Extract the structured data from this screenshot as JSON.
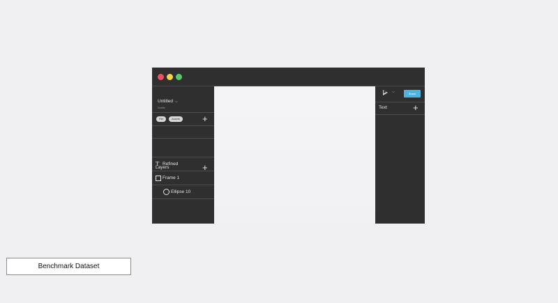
{
  "window": {
    "controls": {
      "close_color": "#e8555e",
      "minimize_color": "#f3d34a",
      "maximize_color": "#58c86a"
    }
  },
  "file": {
    "name": "Untitled",
    "name_chevron": "⌵",
    "subtitle": "Drafts"
  },
  "toolbar": {
    "pills": [
      "File",
      "Assets"
    ],
    "add_glyph": "+"
  },
  "layers": {
    "title": "Layers",
    "add_glyph": "+",
    "items": [
      {
        "label": "Refined",
        "icon": "text-icon",
        "glyph": "T"
      },
      {
        "label": "Frame 1",
        "icon": "frame-icon"
      },
      {
        "label": "Ellipse 10",
        "icon": "ellipse-icon"
      }
    ]
  },
  "right_panel": {
    "play_chevron": "⌵",
    "share_label": "Share",
    "share_color": "#4eb3de",
    "text_section_title": "Text",
    "add_glyph": "+"
  },
  "footer": {
    "label": "Benchmark Dataset"
  }
}
